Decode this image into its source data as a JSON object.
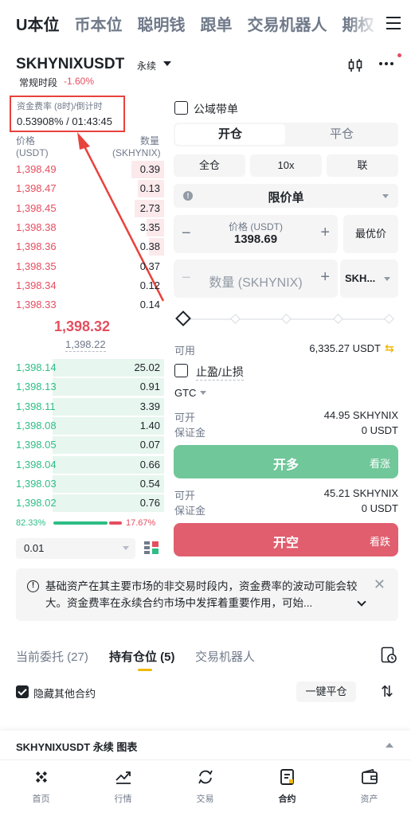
{
  "top_tabs": [
    "U本位",
    "币本位",
    "聪明钱",
    "跟单",
    "交易机器人",
    "期权"
  ],
  "header": {
    "symbol": "SKHYNIXUSDT",
    "contract_type": "永续",
    "session": "常规时段",
    "change": "-1.60%"
  },
  "funding": {
    "label": "资金费率 (8时)/倒计时",
    "value": "0.53908% / 01:43:45"
  },
  "orderbook": {
    "price_header": "价格",
    "price_unit": "(USDT)",
    "qty_header": "数量",
    "qty_unit": "(SKHYNIX)",
    "asks": [
      {
        "price": "1,398.49",
        "qty": "0.39",
        "depth": 0.22
      },
      {
        "price": "1,398.47",
        "qty": "0.13",
        "depth": 0.18
      },
      {
        "price": "1,398.45",
        "qty": "2.73",
        "depth": 0.2
      },
      {
        "price": "1,398.38",
        "qty": "3.35",
        "depth": 0.12
      },
      {
        "price": "1,398.36",
        "qty": "0.38",
        "depth": 0.1
      },
      {
        "price": "1,398.35",
        "qty": "0.37",
        "depth": 0.0
      },
      {
        "price": "1,398.34",
        "qty": "0.12",
        "depth": 0.0
      },
      {
        "price": "1,398.33",
        "qty": "0.14",
        "depth": 0.0
      }
    ],
    "last_price": "1,398.32",
    "mark_price": "1,398.22",
    "bids": [
      {
        "price": "1,398.14",
        "qty": "25.02",
        "depth": 0.75
      },
      {
        "price": "1,398.13",
        "qty": "0.91",
        "depth": 0.75
      },
      {
        "price": "1,398.11",
        "qty": "3.39",
        "depth": 0.75
      },
      {
        "price": "1,398.08",
        "qty": "1.40",
        "depth": 0.75
      },
      {
        "price": "1,398.05",
        "qty": "0.07",
        "depth": 0.75
      },
      {
        "price": "1,398.04",
        "qty": "0.66",
        "depth": 0.75
      },
      {
        "price": "1,398.03",
        "qty": "0.54",
        "depth": 0.75
      },
      {
        "price": "1,398.02",
        "qty": "0.76",
        "depth": 0.75
      }
    ],
    "buy_ratio": "82.33%",
    "sell_ratio": "17.67%",
    "precision": "0.01"
  },
  "trade": {
    "copy_label": "公域带单",
    "open_tab": "开仓",
    "close_tab": "平仓",
    "margin_mode": "全仓",
    "leverage": "10x",
    "position_mode": "联",
    "order_type": "限价单",
    "price_label": "价格 (USDT)",
    "price_value": "1398.69",
    "best_price": "最优价",
    "qty_placeholder": "数量 (SKHYNIX)",
    "qty_unit": "SKH...",
    "available_label": "可用",
    "available_value": "6,335.27 USDT",
    "tpsl_label": "止盈/止损",
    "tif": "GTC",
    "long_can_open_label": "可开",
    "long_can_open_value": "44.95 SKHYNIX",
    "long_margin_label": "保证金",
    "long_margin_value": "0 USDT",
    "long_button": "开多",
    "long_sub": "看涨",
    "short_can_open_label": "可开",
    "short_can_open_value": "45.21 SKHYNIX",
    "short_margin_label": "保证金",
    "short_margin_value": "0 USDT",
    "short_button": "开空",
    "short_sub": "看跌"
  },
  "notice": {
    "text": "基础资产在其主要市场的非交易时段内，资金费率的波动可能会较大。资金费率在永续合约市场中发挥着重要作用，可始..."
  },
  "positions": {
    "tab_orders": "当前委托 (27)",
    "tab_positions": "持有仓位 (5)",
    "tab_bots": "交易机器人",
    "hide_others": "隐藏其他合约",
    "close_all": "一键平仓"
  },
  "chart_bar": {
    "label": "SKHYNIXUSDT 永续 图表"
  },
  "nav": {
    "home": "首页",
    "markets": "行情",
    "trade": "交易",
    "futures": "合约",
    "assets": "资产"
  },
  "colors": {
    "up": "#2ebd85",
    "down": "#e54e5f",
    "accent": "#f0b90b",
    "annotation": "#e8423c"
  }
}
